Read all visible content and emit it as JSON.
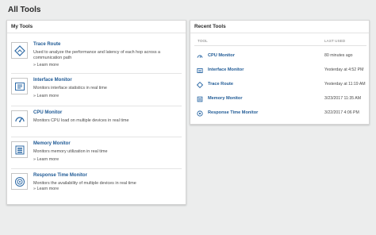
{
  "page": {
    "title": "All Tools"
  },
  "my_tools": {
    "title": "My Tools",
    "learn_more": "» Learn more",
    "items": [
      {
        "name": "Trace Route",
        "icon": "trace-route-icon",
        "desc": "Used to analyze the performance and latency of each hop across a communication path"
      },
      {
        "name": "Interface Monitor",
        "icon": "interface-monitor-icon",
        "desc": "Monitors interface statistics in real time"
      },
      {
        "name": "CPU Monitor",
        "icon": "cpu-gauge-icon",
        "desc": "Monitors CPU load on multiple devices in real time"
      },
      {
        "name": "Memory Monitor",
        "icon": "memory-monitor-icon",
        "desc": "Monitors memory utilization in real time"
      },
      {
        "name": "Response Time Monitor",
        "icon": "response-time-icon",
        "desc": "Monitors the availability of multiple devices in real time"
      }
    ]
  },
  "recent_tools": {
    "title": "Recent Tools",
    "col_tool": "TOOL",
    "col_last_used": "LAST USED",
    "rows": [
      {
        "name": "CPU Monitor",
        "icon": "cpu-gauge-icon",
        "last_used": "80 minutes ago"
      },
      {
        "name": "Interface Monitor",
        "icon": "interface-monitor-icon",
        "last_used": "Yesterday at 4:52 PM"
      },
      {
        "name": "Trace Route",
        "icon": "trace-route-icon",
        "last_used": "Yesterday at 11:19 AM"
      },
      {
        "name": "Memory Monitor",
        "icon": "memory-monitor-icon",
        "last_used": "3/23/2017 11:35 AM"
      },
      {
        "name": "Response Time Monitor",
        "icon": "response-time-icon",
        "last_used": "3/22/2017 4:06 PM"
      }
    ]
  },
  "colors": {
    "link": "#1f5a95",
    "icon": "#2e6aa6",
    "background": "#eceded"
  }
}
